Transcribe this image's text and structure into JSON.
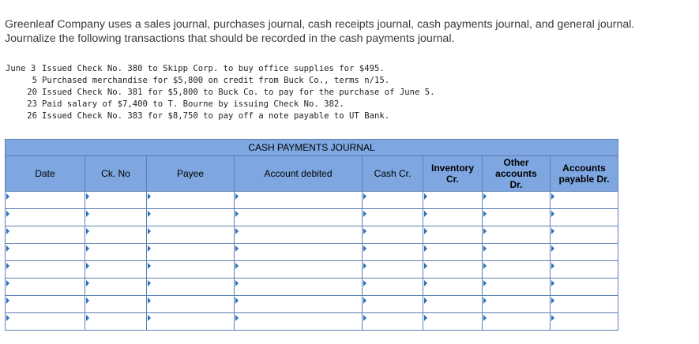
{
  "intro": {
    "line1": "Greenleaf Company uses a sales journal, purchases journal, cash receipts journal, cash payments journal, and general journal.",
    "line2": "Journalize the following transactions that should be recorded in the cash payments journal."
  },
  "transactions": [
    {
      "date": "June 3",
      "text": "Issued Check No. 380 to Skipp Corp. to buy office supplies for $495."
    },
    {
      "date": "5",
      "text": "Purchased merchandise for $5,800 on credit from Buck Co., terms n/15."
    },
    {
      "date": "20",
      "text": "Issued Check No. 381 for $5,800 to Buck Co. to pay for the purchase of June 5."
    },
    {
      "date": "23",
      "text": "Paid salary of $7,400 to T. Bourne by issuing Check No. 382."
    },
    {
      "date": "26",
      "text": "Issued Check No. 383 for $8,750 to pay off a note payable to UT Bank."
    }
  ],
  "journal": {
    "title": "CASH PAYMENTS JOURNAL",
    "columns": [
      "Date",
      "Ck. No",
      "Payee",
      "Account debited",
      "Cash Cr.",
      "Inventory\nCr.",
      "Other\naccounts\nDr.",
      "Accounts\npayable Dr."
    ],
    "rows": 8,
    "colors": {
      "header_bg": "#7ea6e0",
      "border": "#5d80b5",
      "marker": "#2a6ebb"
    }
  }
}
